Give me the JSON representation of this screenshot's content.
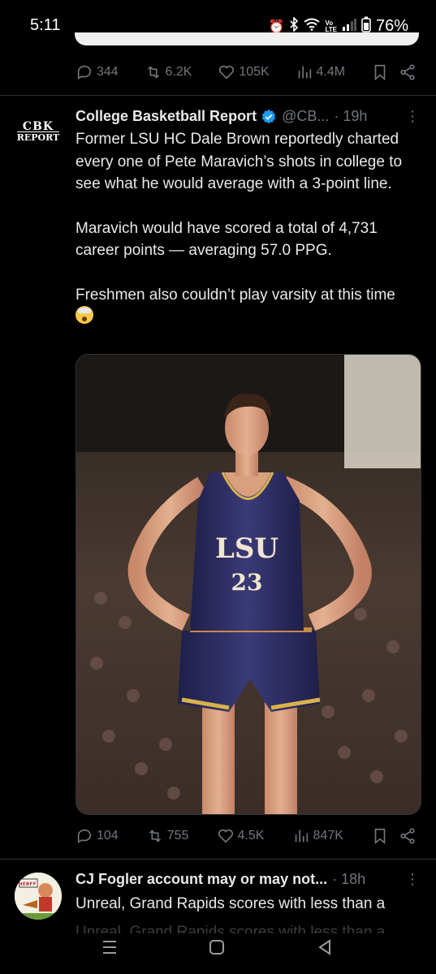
{
  "status_bar": {
    "time": "5:11",
    "volte_top": "Vo",
    "volte_bottom": "LTE",
    "battery": "76%"
  },
  "prev_tweet": {
    "replies": "344",
    "reposts": "6.2K",
    "likes": "105K",
    "views": "4.4M"
  },
  "tweet": {
    "author_name": "College Basketball Report",
    "handle": "@CB...",
    "time": "· 19h",
    "avatar_text_top": "CBK",
    "avatar_text_bottom": "REPORT",
    "paragraphs": [
      "Former LSU HC Dale Brown reportedly charted every one of Pete Maravich’s shots in college to see what he would average with a 3-point line.",
      "Maravich would have scored a total of 4,731 career points — averaging 57.0 PPG.",
      "Freshmen also couldn’t play varsity at this time"
    ],
    "jersey_text": "LSU",
    "jersey_number": "23",
    "replies": "104",
    "reposts": "755",
    "likes": "4.5K",
    "views": "847K"
  },
  "next_tweet": {
    "author_name": "CJ Fogler account may or may not...",
    "time": "· 18h",
    "text": "Unreal, Grand Rapids scores with less than a",
    "avatar_text": "HEBFF!",
    "behind_text": "Unreal, Grand Rapids scores with less than a"
  },
  "colors": {
    "background": "#000000",
    "muted": "#71767b",
    "text": "#e7e9ea",
    "verified": "#1d9bf0",
    "divider": "#2f3336"
  }
}
